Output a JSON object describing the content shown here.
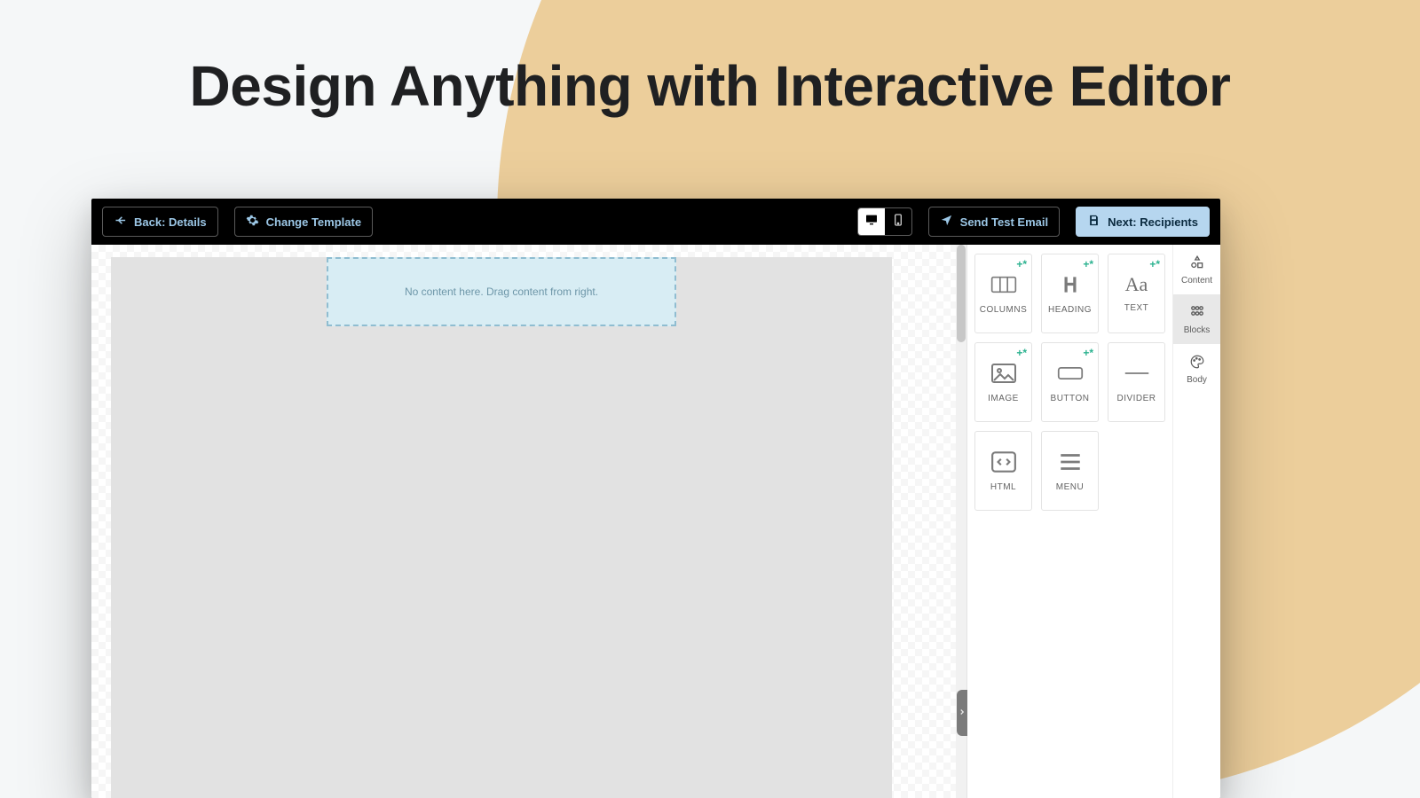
{
  "hero": {
    "title": "Design Anything  with  Interactive Editor"
  },
  "toolbar": {
    "back_label": "Back: Details",
    "change_template_label": "Change Template",
    "send_test_label": "Send Test Email",
    "next_label": "Next: Recipients"
  },
  "canvas": {
    "dropzone_text": "No content here. Drag content from right."
  },
  "blocks": {
    "columns": "COLUMNS",
    "heading": "HEADING",
    "text": "TEXT",
    "image": "IMAGE",
    "button": "BUTTON",
    "divider": "DIVIDER",
    "html": "HTML",
    "menu": "MENU"
  },
  "side_tabs": {
    "content": "Content",
    "blocks": "Blocks",
    "body": "Body"
  }
}
